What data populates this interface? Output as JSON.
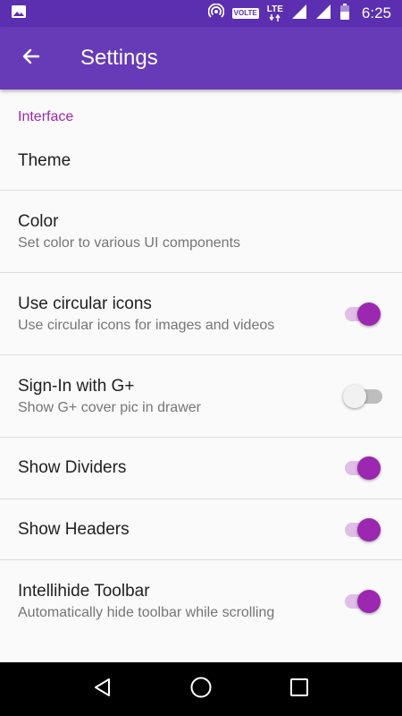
{
  "status_bar": {
    "time": "6:25",
    "volte": "VOLTE",
    "lte": "LTE",
    "icons": [
      "image-icon",
      "hotspot-icon",
      "volte-icon",
      "lte-icon",
      "signal-icon",
      "signal-icon",
      "battery-icon"
    ]
  },
  "app_bar": {
    "title": "Settings",
    "back_icon": "arrow-back-icon"
  },
  "section": {
    "header": "Interface"
  },
  "prefs": [
    {
      "title": "Theme",
      "summary": ""
    },
    {
      "title": "Color",
      "summary": "Set color to various UI components"
    },
    {
      "title": "Use circular icons",
      "summary": "Use circular icons for images and videos",
      "switch": true
    },
    {
      "title": "Sign-In with G+",
      "summary": "Show G+ cover pic in drawer",
      "switch": false
    },
    {
      "title": "Show Dividers",
      "summary": "",
      "switch": true
    },
    {
      "title": "Show Headers",
      "summary": "",
      "switch": true
    },
    {
      "title": "Intellihide Toolbar",
      "summary": "Automatically hide toolbar while scrolling",
      "switch": true
    }
  ],
  "nav_bar": {
    "icons": [
      "back-triangle-icon",
      "home-circle-icon",
      "recents-square-icon"
    ]
  },
  "colors": {
    "status_bar": "#5b2fb0",
    "app_bar": "#673ab7",
    "accent": "#9c27b0",
    "accent_track": "#e1bee7",
    "switch_off_thumb": "#f1f1f1",
    "switch_off_track": "#bdbdbd"
  }
}
